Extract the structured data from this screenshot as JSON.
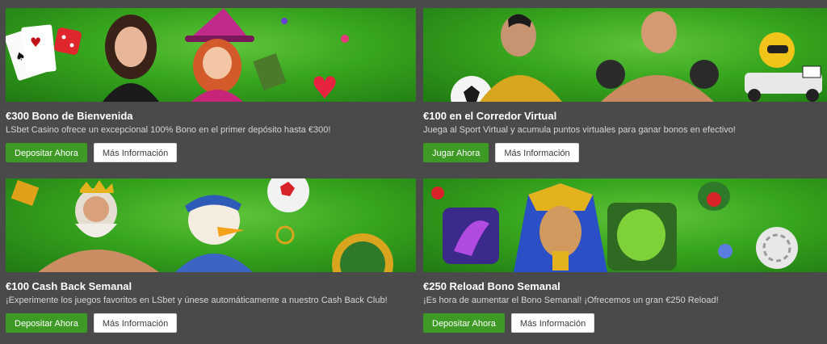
{
  "colors": {
    "page_bg": "#4a4a4a",
    "banner_green": "#37a51e",
    "primary_button": "#3d9a25",
    "secondary_button": "#ffffff",
    "title_text": "#ffffff",
    "desc_text": "#d6d6d6"
  },
  "promos": [
    {
      "title": "€300 Bono de Bienvenida",
      "description": "LSbet Casino ofrece un excepcional 100% Bono en el primer depósito hasta €300!",
      "primary_label": "Depositar Ahora",
      "secondary_label": "Más Información",
      "banner_icon": "casino-cards-witch-banner"
    },
    {
      "title": "€100 en el Corredor Virtual",
      "description": "Juega al Sport Virtual y acumula puntos virtuales para ganar bonos en efectivo!",
      "primary_label": "Jugar Ahora",
      "secondary_label": "Más Información",
      "banner_icon": "virtual-sports-athletes-banner"
    },
    {
      "title": "€100 Cash Back Semanal",
      "description": "¡Experimente los juegos favoritos en LSbet y únese automáticamente a nuestro Cash Back Club!",
      "primary_label": "Depositar Ahora",
      "secondary_label": "Más Información",
      "banner_icon": "zeus-chicken-banner"
    },
    {
      "title": "€250 Reload Bono Semanal",
      "description": "¡Es hora de aumentar el Bono Semanal! ¡Ofrecemos un gran €250 Reload!",
      "primary_label": "Depositar Ahora",
      "secondary_label": "Más Información",
      "banner_icon": "pharaoh-slots-banner"
    }
  ]
}
